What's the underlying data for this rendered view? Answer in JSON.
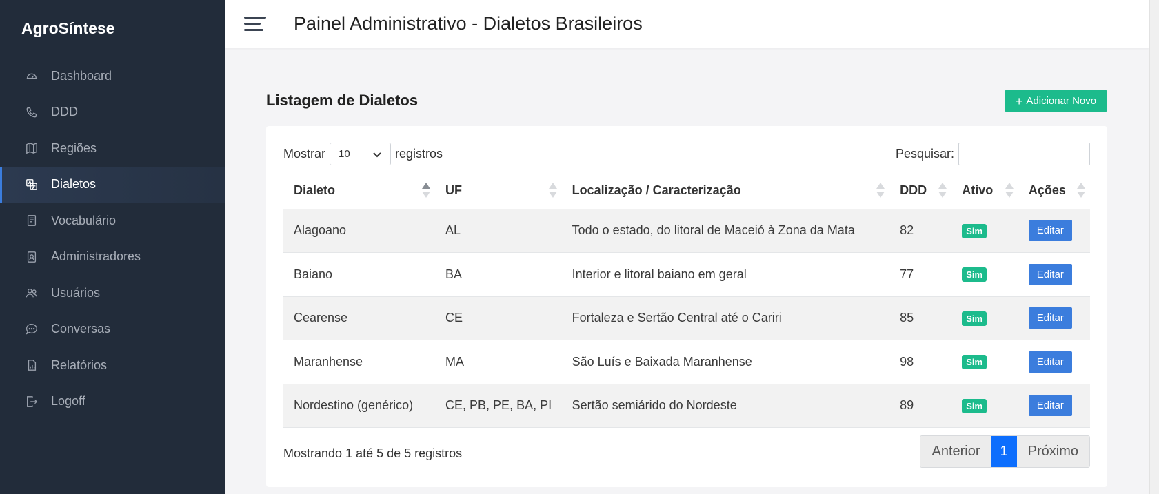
{
  "sidebar": {
    "brand": "AgroSíntese",
    "items": [
      {
        "label": "Dashboard",
        "icon": "speedometer-icon"
      },
      {
        "label": "DDD",
        "icon": "phone-icon"
      },
      {
        "label": "Regiões",
        "icon": "map-icon"
      },
      {
        "label": "Dialetos",
        "icon": "translate-icon",
        "active": true
      },
      {
        "label": "Vocabulário",
        "icon": "journal-icon"
      },
      {
        "label": "Administradores",
        "icon": "person-badge-icon"
      },
      {
        "label": "Usuários",
        "icon": "people-icon"
      },
      {
        "label": "Conversas",
        "icon": "chat-icon"
      },
      {
        "label": "Relatórios",
        "icon": "report-icon"
      },
      {
        "label": "Logoff",
        "icon": "logout-icon"
      }
    ]
  },
  "header": {
    "title": "Painel Administrativo - Dialetos Brasileiros"
  },
  "main": {
    "section_title": "Listagem de Dialetos",
    "add_button": "Adicionar Novo",
    "show_prefix": "Mostrar",
    "show_value": "10",
    "show_suffix": "registros",
    "search_label": "Pesquisar:",
    "search_value": "",
    "columns": [
      "Dialeto",
      "UF",
      "Localização / Caracterização",
      "DDD",
      "Ativo",
      "Ações"
    ],
    "rows": [
      {
        "dialeto": "Alagoano",
        "uf": "AL",
        "localizacao": "Todo o estado, do litoral de Maceió à Zona da Mata",
        "ddd": "82",
        "ativo": "Sim",
        "acao": "Editar"
      },
      {
        "dialeto": "Baiano",
        "uf": "BA",
        "localizacao": "Interior e litoral baiano em geral",
        "ddd": "77",
        "ativo": "Sim",
        "acao": "Editar"
      },
      {
        "dialeto": "Cearense",
        "uf": "CE",
        "localizacao": "Fortaleza e Sertão Central até o Cariri",
        "ddd": "85",
        "ativo": "Sim",
        "acao": "Editar"
      },
      {
        "dialeto": "Maranhense",
        "uf": "MA",
        "localizacao": "São Luís e Baixada Maranhense",
        "ddd": "98",
        "ativo": "Sim",
        "acao": "Editar"
      },
      {
        "dialeto": "Nordestino (genérico)",
        "uf": "CE, PB, PE, BA, PI",
        "localizacao": "Sertão semiárido do Nordeste",
        "ddd": "89",
        "ativo": "Sim",
        "acao": "Editar"
      }
    ],
    "info_text": "Mostrando 1 até 5 de 5 registros",
    "pager": {
      "prev": "Anterior",
      "current": "1",
      "next": "Próximo"
    }
  },
  "colors": {
    "sidebar_bg": "#222c3a",
    "accent_blue": "#3b7ddd",
    "success_green": "#1cbb8c",
    "pager_active": "#0d6efd"
  }
}
